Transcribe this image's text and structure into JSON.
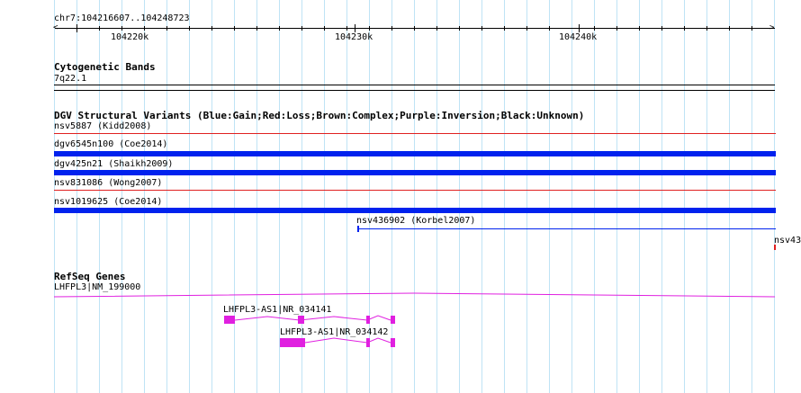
{
  "location": "chr7:104216607..104248723",
  "ruler": {
    "ticks": [
      "104220k",
      "104230k",
      "104240k"
    ],
    "left_arrow": "<",
    "right_arrow": ">"
  },
  "cytoband": {
    "title": "Cytogenetic Bands",
    "band": "7q22.1"
  },
  "dgv": {
    "title": "DGV Structural Variants (Blue:Gain;Red:Loss;Brown:Complex;Purple:Inversion;Black:Unknown)",
    "variants": [
      {
        "label": "nsv5887 (Kidd2008)",
        "type": "loss",
        "color": "#e02020"
      },
      {
        "label": "dgv6545n100 (Coe2014)",
        "type": "gain",
        "color": "#0022ee"
      },
      {
        "label": "dgv425n21 (Shaikh2009)",
        "type": "gain",
        "color": "#0022ee"
      },
      {
        "label": "nsv831086 (Wong2007)",
        "type": "loss",
        "color": "#e02020"
      },
      {
        "label": "nsv1019625 (Coe2014)",
        "type": "gain",
        "color": "#0022ee"
      },
      {
        "label": "nsv436902 (Korbel2007)",
        "type": "gain",
        "color": "#0022ee"
      },
      {
        "label": "nsv43",
        "type": "loss",
        "color": "#e02020"
      }
    ]
  },
  "refseq": {
    "title": "RefSeq Genes",
    "color": "#e020e0",
    "genes": [
      {
        "label": "LHFPL3|NM_199000"
      },
      {
        "label": "LHFPL3-AS1|NR_034141"
      },
      {
        "label": "LHFPL3-AS1|NR_034142"
      }
    ]
  },
  "colors": {
    "gridline": "#bfe3f5",
    "gain": "#0022ee",
    "loss": "#e02020",
    "gene": "#e020e0"
  }
}
